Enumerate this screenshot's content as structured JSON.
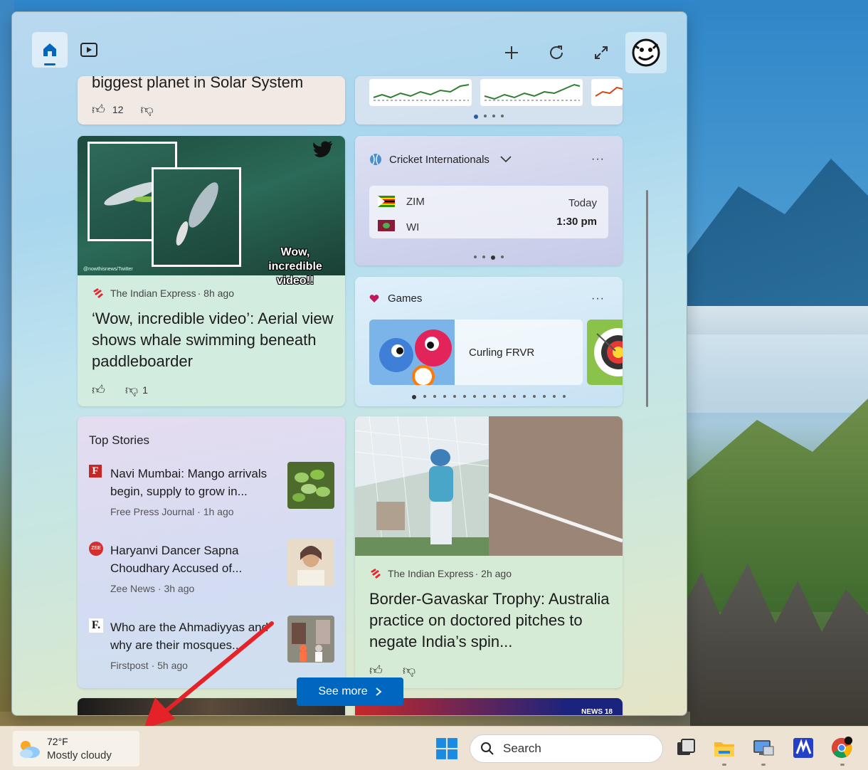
{
  "topbar": {
    "home_icon": "home-icon",
    "video_icon": "video-icon",
    "add_icon": "plus-icon",
    "refresh_icon": "refresh-icon",
    "expand_icon": "expand-icon",
    "profile_icon": "avatar"
  },
  "card_top_left": {
    "headline_fragment": "biggest planet in Solar System",
    "like_count": "12"
  },
  "whale_card": {
    "overlay_text": "Wow, incredible video!!",
    "watermark": "@nowthisnews/Twitter",
    "source": "The Indian Express",
    "time": "· 8h ago",
    "headline": "‘Wow, incredible video’: Aerial view shows whale swimming beneath paddleboarder",
    "dislike_count": "1"
  },
  "cricket_card": {
    "title": "Cricket Internationals",
    "more": "···",
    "team1": "ZIM",
    "team2": "WI",
    "day": "Today",
    "time": "1:30 pm",
    "team1_flag": "flag-zimbabwe",
    "team2_flag": "flag-west-indies"
  },
  "games_card": {
    "title": "Games",
    "more": "···",
    "game_name": "Curling FRVR"
  },
  "top_stories": {
    "title": "Top Stories",
    "items": [
      {
        "logo": "F",
        "headline": "Navi Mumbai: Mango arrivals begin, supply to grow in...",
        "meta": "Free Press Journal · 1h ago"
      },
      {
        "logo": "ZEE",
        "headline": "Haryanvi Dancer Sapna Choudhary Accused of...",
        "meta": "Zee News · 3h ago"
      },
      {
        "logo": "F.",
        "headline": "Who are the Ahmadiyyas and why are their mosques...",
        "meta": "Firstpost · 5h ago"
      }
    ]
  },
  "cricket_news_card": {
    "source": "The Indian Express",
    "time": "· 2h ago",
    "headline": "Border-Gavaskar Trophy: Australia practice on doctored pitches to negate India’s spin..."
  },
  "see_more": {
    "label": "See more"
  },
  "bottom_peek": {
    "badge": "NEWS 18"
  },
  "taskbar": {
    "weather_temp": "72°F",
    "weather_desc": "Mostly cloudy",
    "search_placeholder": "Search"
  },
  "colors": {
    "accent": "#0067c0",
    "indian_express_red": "#e8232a"
  }
}
